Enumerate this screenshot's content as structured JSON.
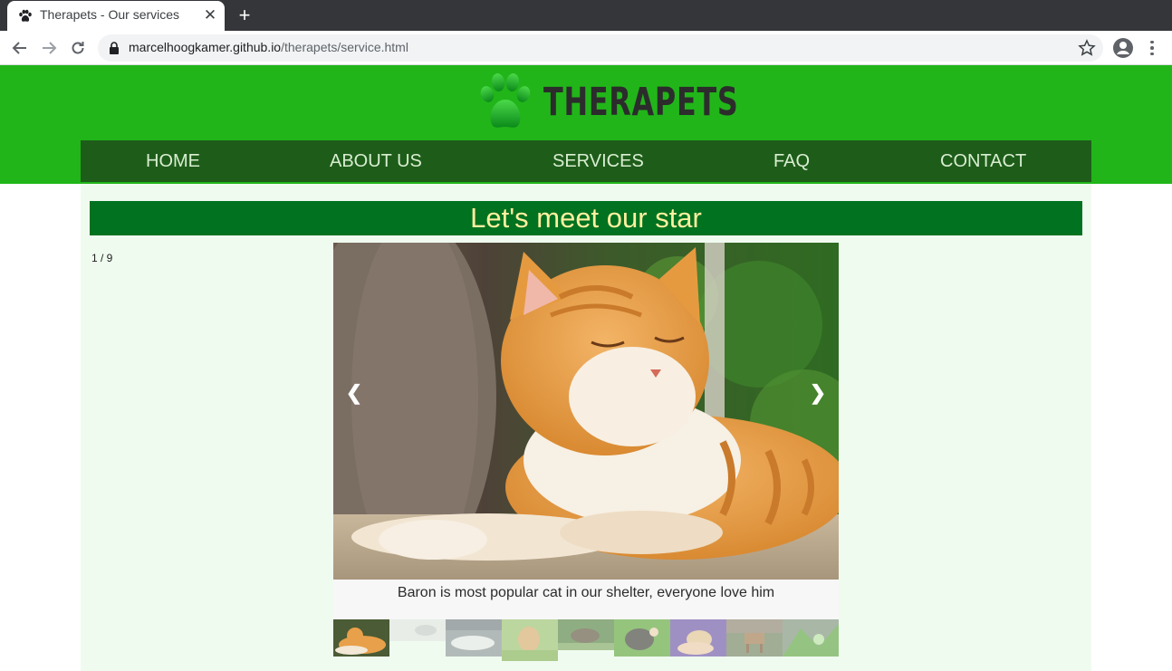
{
  "browser": {
    "tab_title": "Therapets - Our services",
    "url_host": "marcelhoogkamer.github.io",
    "url_path": "/therapets/service.html"
  },
  "site": {
    "logo_text": "THERAPETS",
    "brand_color": "#21b519",
    "nav_color": "#1e5c1a",
    "nav": [
      {
        "label": "HOME"
      },
      {
        "label": "ABOUT US"
      },
      {
        "label": "SERVICES"
      },
      {
        "label": "FAQ"
      },
      {
        "label": "CONTACT"
      }
    ]
  },
  "gallery": {
    "title": "Let's meet our star",
    "counter": "1 / 9",
    "prev_symbol": "❮",
    "next_symbol": "❯",
    "caption": "Baron is most popular cat in our shelter, everyone love him",
    "current": 1,
    "total": 9
  }
}
